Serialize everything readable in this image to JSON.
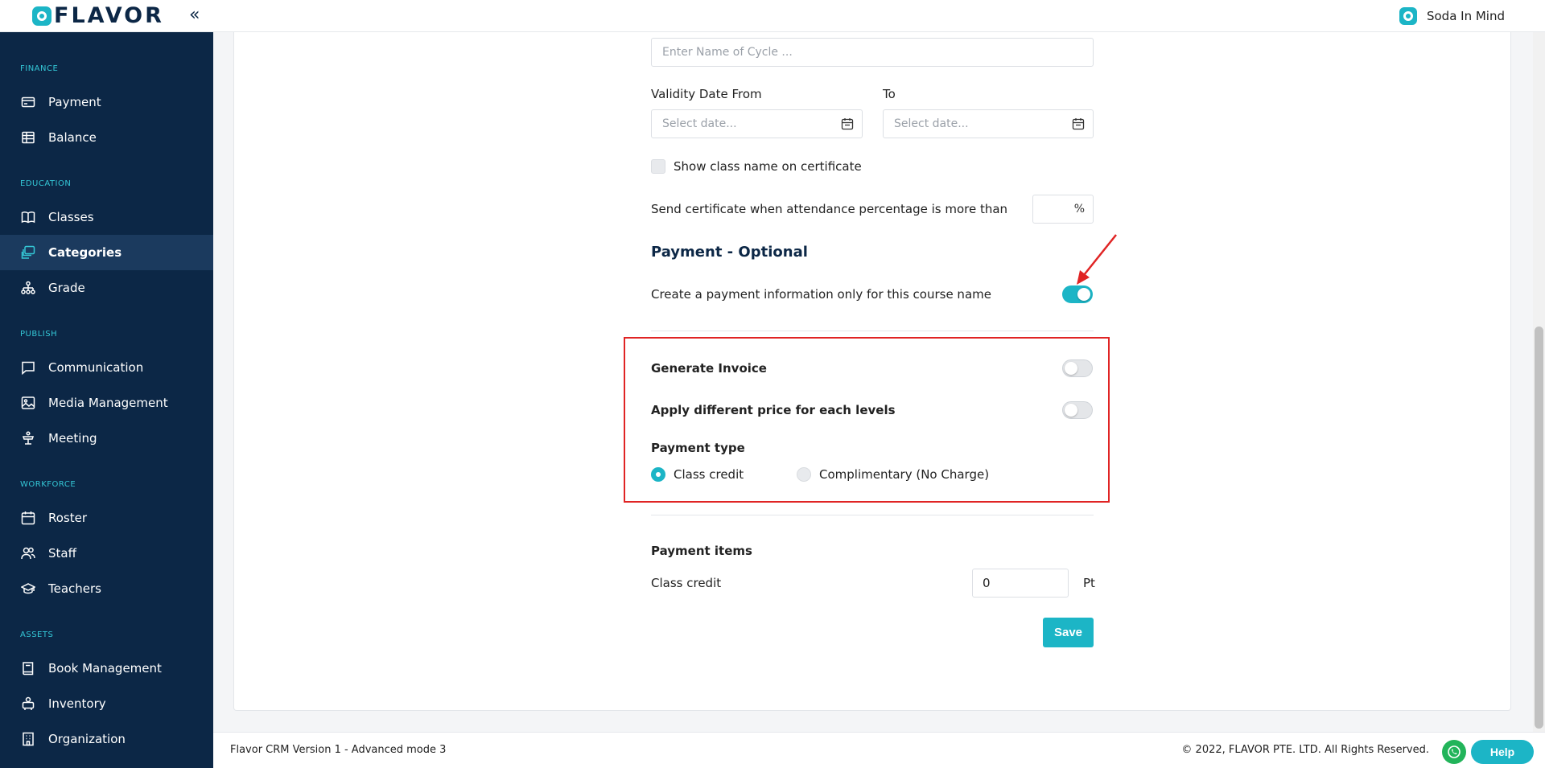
{
  "app": {
    "logo_text": "FLAVOR",
    "organization": "Soda In Mind"
  },
  "colors": {
    "sidebar_bg": "#0c2746",
    "accent": "#1cb5c6",
    "highlight": "#e02424"
  },
  "sidebar": {
    "sections": [
      {
        "title": "FINANCE",
        "items": [
          {
            "label": "Payment",
            "icon": "credit-card-icon"
          },
          {
            "label": "Balance",
            "icon": "ledger-icon"
          }
        ]
      },
      {
        "title": "EDUCATION",
        "items": [
          {
            "label": "Classes",
            "icon": "book-icon"
          },
          {
            "label": "Categories",
            "icon": "layers-icon",
            "active": true
          },
          {
            "label": "Grade",
            "icon": "hierarchy-icon"
          }
        ]
      },
      {
        "title": "PUBLISH",
        "items": [
          {
            "label": "Communication",
            "icon": "chat-icon"
          },
          {
            "label": "Media Management",
            "icon": "image-icon"
          },
          {
            "label": "Meeting",
            "icon": "podium-icon"
          }
        ]
      },
      {
        "title": "WORKFORCE",
        "items": [
          {
            "label": "Roster",
            "icon": "calendar-icon"
          },
          {
            "label": "Staff",
            "icon": "users-icon"
          },
          {
            "label": "Teachers",
            "icon": "graduation-cap-icon"
          }
        ]
      },
      {
        "title": "ASSETS",
        "items": [
          {
            "label": "Book Management",
            "icon": "book-closed-icon"
          },
          {
            "label": "Inventory",
            "icon": "box-icon"
          },
          {
            "label": "Organization",
            "icon": "building-icon"
          }
        ]
      }
    ]
  },
  "form": {
    "cycle_name_placeholder": "Enter Name of Cycle ...",
    "validity_from_label": "Validity Date From",
    "validity_to_label": "To",
    "date_placeholder": "Select date...",
    "show_class_name_label": "Show class name on certificate",
    "show_class_name_checked": false,
    "send_certificate_label": "Send certificate when attendance percentage is more than",
    "percent_suffix": "%",
    "percent_value": ""
  },
  "payment": {
    "heading": "Payment - Optional",
    "create_payment_label": "Create a payment information only for this course name",
    "create_payment_on": true,
    "generate_invoice_label": "Generate Invoice",
    "generate_invoice_on": false,
    "apply_price_label": "Apply different price for each levels",
    "apply_price_on": false,
    "payment_type_label": "Payment type",
    "payment_type_options": [
      "Class credit",
      "Complimentary (No Charge)"
    ],
    "payment_type_selected": "Class credit",
    "items_heading": "Payment items",
    "class_credit_label": "Class credit",
    "class_credit_value": "0",
    "class_credit_unit": "Pt",
    "save_label": "Save"
  },
  "footer": {
    "version": "Flavor CRM Version 1 - Advanced mode 3",
    "copyright": "© 2022, FLAVOR PTE. LTD. All Rights Reserved.",
    "help_label": "Help"
  }
}
